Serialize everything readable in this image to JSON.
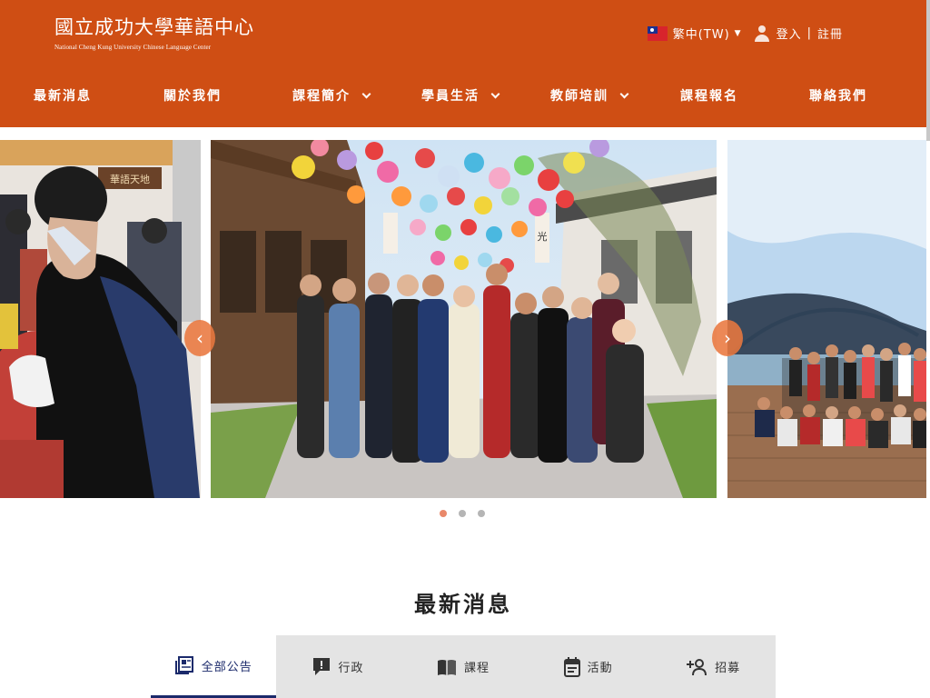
{
  "header": {
    "logo_cn": "國立成功大學華語中心",
    "logo_en": "National Cheng Kung University Chinese Language Center",
    "language": "繁中(TW)",
    "login": "登入",
    "separator": "|",
    "register": "註冊"
  },
  "nav": {
    "items": [
      {
        "label": "最新消息",
        "has_dropdown": false
      },
      {
        "label": "關於我們",
        "has_dropdown": false
      },
      {
        "label": "課程簡介",
        "has_dropdown": true
      },
      {
        "label": "學員生活",
        "has_dropdown": true
      },
      {
        "label": "教師培訓",
        "has_dropdown": true
      },
      {
        "label": "課程報名",
        "has_dropdown": false
      },
      {
        "label": "聯絡我們",
        "has_dropdown": false
      }
    ]
  },
  "carousel": {
    "prev_icon": "chevron-left-icon",
    "next_icon": "chevron-right-icon",
    "slide_count": 3,
    "active_index": 0,
    "signs": [
      "華語天地",
      "光"
    ]
  },
  "news": {
    "title": "最新消息",
    "tabs": [
      {
        "label": "全部公告",
        "icon": "newspaper-icon",
        "active": true
      },
      {
        "label": "行政",
        "icon": "announcement-icon",
        "active": false
      },
      {
        "label": "課程",
        "icon": "book-icon",
        "active": false
      },
      {
        "label": "活動",
        "icon": "calendar-icon",
        "active": false
      },
      {
        "label": "招募",
        "icon": "add-user-icon",
        "active": false
      }
    ]
  },
  "colors": {
    "brand": "#cf4e14",
    "arrow": "#e9783f",
    "active_tab": "#1b2a6b",
    "dot_active": "#e9886a"
  }
}
